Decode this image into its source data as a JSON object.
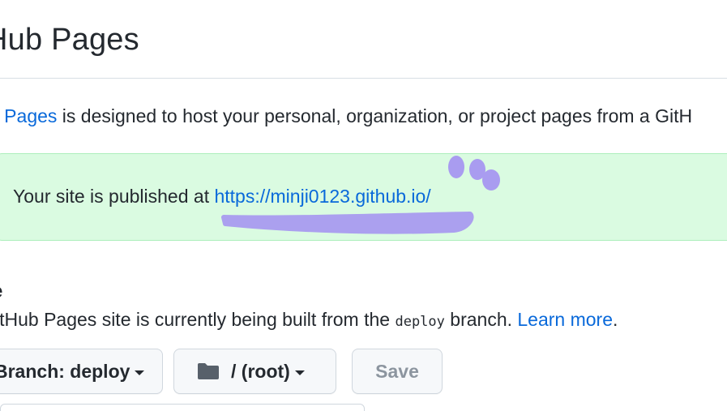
{
  "header": {
    "title": "Hub Pages"
  },
  "intro": {
    "link_text": "b Pages",
    "rest_text": " is designed to host your personal, organization, or project pages from a GitH"
  },
  "flash": {
    "prefix": "Your site is published at ",
    "url": "https://minji0123.github.io/"
  },
  "source": {
    "heading": "e",
    "desc_before": "itHub Pages site is currently being built from the ",
    "branch_code": "deploy",
    "desc_after": " branch. ",
    "learn_more": "Learn more",
    "period": "."
  },
  "controls": {
    "branch_label": "Branch: deploy",
    "folder_label": "/ (root)",
    "save_label": "Save"
  },
  "icons": {
    "folder": "folder-icon",
    "caret": "caret-down-icon"
  },
  "colors": {
    "link": "#0969da",
    "flash_bg": "#dafbe1",
    "flash_border": "#aceebb",
    "scribble": "#a99cf0"
  }
}
